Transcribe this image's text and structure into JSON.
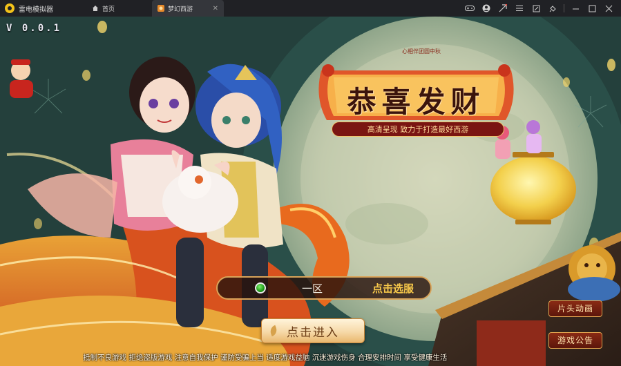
{
  "app": {
    "name": "雷电模拟器",
    "logo_icon": "thunder-logo-icon"
  },
  "tabs": [
    {
      "label": "首页",
      "icon": "home-icon"
    },
    {
      "label": "梦幻西游",
      "icon": "game-icon",
      "active": true
    }
  ],
  "window_controls": [
    "gamepad-icon",
    "user-avatar-icon",
    "send-icon",
    "menu-icon",
    "restore-icon",
    "pin-icon",
    "minimize-icon",
    "maximize-icon",
    "close-icon"
  ],
  "game": {
    "version": "V 0.0.1",
    "banner_top": "心相伴团圆中秋",
    "banner_title": "恭喜发财",
    "banner_subtitle": "高清呈现 致力于打造最好西游",
    "server": {
      "status_color": "#2bbd22",
      "name": "一区",
      "select_label": "点击选服"
    },
    "enter_label": "点击进入",
    "side_buttons": {
      "cutscene": "片头动画",
      "notice": "游戏公告"
    },
    "health_notice": "抵制不良游戏 拒绝盗版游戏 注意自我保护 谨防受骗上当 适度游戏益脑 沉迷游戏伤身 合理安排时间 享受健康生活"
  },
  "colors": {
    "titlebar": "#202125",
    "active_tab": "#34363b",
    "accent_gold": "#f7c84a",
    "banner_red": "#7a1512"
  }
}
